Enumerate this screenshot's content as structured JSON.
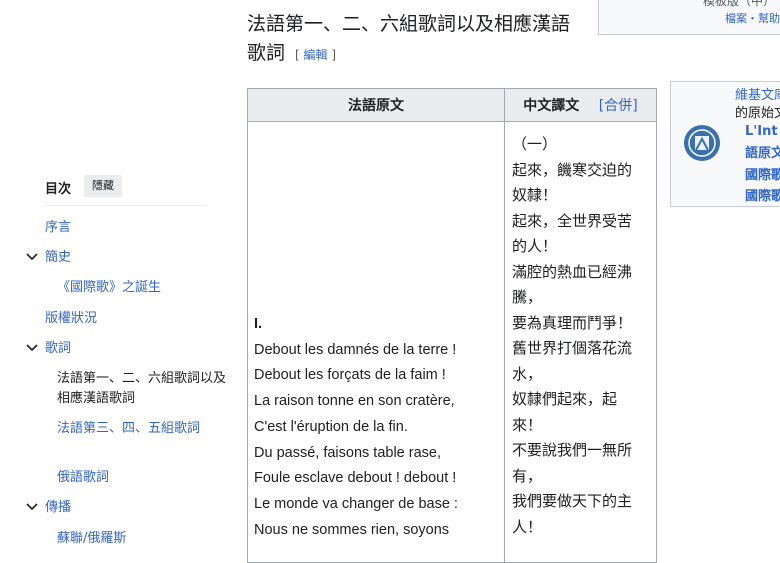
{
  "top_box": {
    "line1": "模板版（中）",
    "line2": "檔案・幫助"
  },
  "heading": {
    "title": "法語第一、二、六組歌詞以及相應漢語歌詞",
    "edit_open": "[ ",
    "edit_label": "編輯",
    "edit_close": " ]"
  },
  "toc": {
    "title": "目次",
    "hide_label": "隱藏",
    "items": [
      {
        "label": "序言"
      },
      {
        "label": "簡史"
      },
      {
        "label": "《國際歌》之誕生"
      },
      {
        "label": "版權狀況"
      },
      {
        "label": "歌詞"
      },
      {
        "label": "法語第一、二、六組歌詞以及相應漢語歌詞"
      },
      {
        "label": "法語第三、四、五組歌詞"
      },
      {
        "label": "俄語歌詞"
      },
      {
        "label": "傳播"
      },
      {
        "label": "蘇聯/俄羅斯"
      }
    ]
  },
  "table": {
    "header_fr": "法語原文",
    "header_zh": "中文譯文",
    "merge_open": "[",
    "merge_label": "合併",
    "merge_close": "]",
    "verse_number": "I.",
    "french_lines": [
      "Debout les damnés de la terre !",
      "Debout les forçats de la faim !",
      "La raison tonne en son cratère,",
      "C'est l'éruption de la fin.",
      "Du passé, faisons table rase,",
      "Foule esclave debout ! debout !",
      "Le monde va changer de base :",
      "Nous ne sommes rien, soyons"
    ],
    "chinese_lines": [
      "（一）",
      "起來，饑寒交迫的",
      "奴隸！",
      "起來，全世界受苦",
      "的人！",
      "滿腔的熱血已經沸",
      "騰，",
      "要為真理而鬥爭！",
      "舊世界打個落花流",
      "水，",
      "奴隸們起來，起",
      "來！",
      "不要說我們一無所",
      "有，",
      "我們要做天下的主",
      "人！"
    ]
  },
  "sister": {
    "title": "維基文庫",
    "subtitle": "的原始文",
    "link1": "L'Int",
    "link2": "語原文",
    "link3": "國際歌",
    "link4": "國際歌"
  }
}
